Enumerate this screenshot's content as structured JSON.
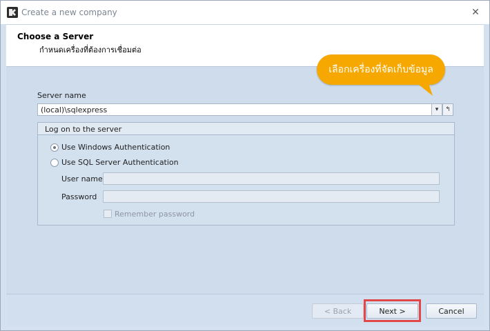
{
  "window": {
    "title": "Create a new company",
    "close_glyph": "✕"
  },
  "header": {
    "title": "Choose a Server",
    "subtitle": "กำหนดเครื่องที่ต้องการเชื่อมต่อ"
  },
  "callout": {
    "text": "เลือกเครื่องที่จัดเก็บข้อมูล",
    "color": "#f6a800"
  },
  "server": {
    "label": "Server name",
    "value": "(local)\\sqlexpress",
    "dropdown_glyph": "▾",
    "reset_glyph": "↰"
  },
  "logon": {
    "title": "Log on to the server",
    "windows_auth": "Use Windows Authentication",
    "sql_auth": "Use SQL Server Authentication",
    "selected": "windows",
    "username_label": "User name",
    "password_label": "Password",
    "username_value": "",
    "password_value": "",
    "remember_label": "Remember password",
    "remember_checked": false
  },
  "footer": {
    "back": "< Back",
    "next": "Next >",
    "cancel": "Cancel",
    "highlight_color": "#e14747"
  },
  "icons": [
    "app-icon",
    "close-icon",
    "dropdown-arrow-icon",
    "reset-icon"
  ]
}
